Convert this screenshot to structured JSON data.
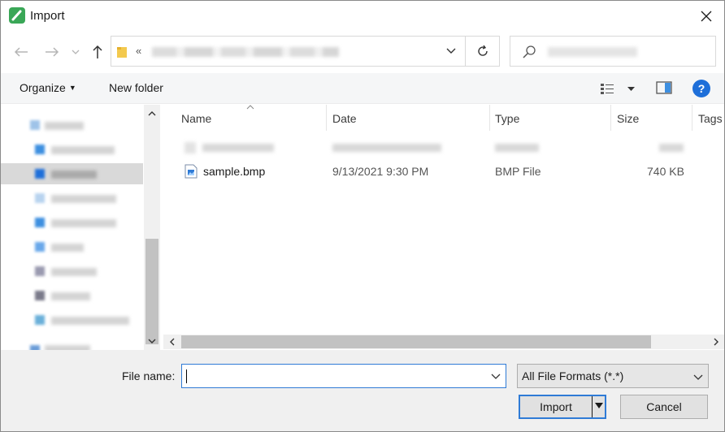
{
  "window": {
    "title": "Import"
  },
  "icons": {
    "app": "app-icon",
    "close": "close-icon",
    "back": "arrow-left-icon",
    "forward": "arrow-right-icon",
    "recent": "chevron-down-icon",
    "up": "arrow-up-icon",
    "folder": "folder-icon",
    "refresh": "refresh-icon",
    "search": "search-icon",
    "help": "help-icon"
  },
  "address": {
    "prefix": "«"
  },
  "toolbar": {
    "organize": "Organize",
    "new_folder": "New folder",
    "help": "?"
  },
  "columns": {
    "name": "Name",
    "date": "Date",
    "type": "Type",
    "size": "Size",
    "tags": "Tags"
  },
  "files": [
    {
      "name": "sample.bmp",
      "date": "9/13/2021 9:30 PM",
      "type": "BMP File",
      "size": "740 KB"
    }
  ],
  "bottom": {
    "file_name_label": "File name:",
    "file_name_value": "",
    "filter_value": "All File Formats (*.*)",
    "import_label": "Import",
    "cancel_label": "Cancel"
  },
  "colors": {
    "accent": "#2f7bd6",
    "help": "#1e6fd9",
    "selection": "#d9d9d9"
  }
}
